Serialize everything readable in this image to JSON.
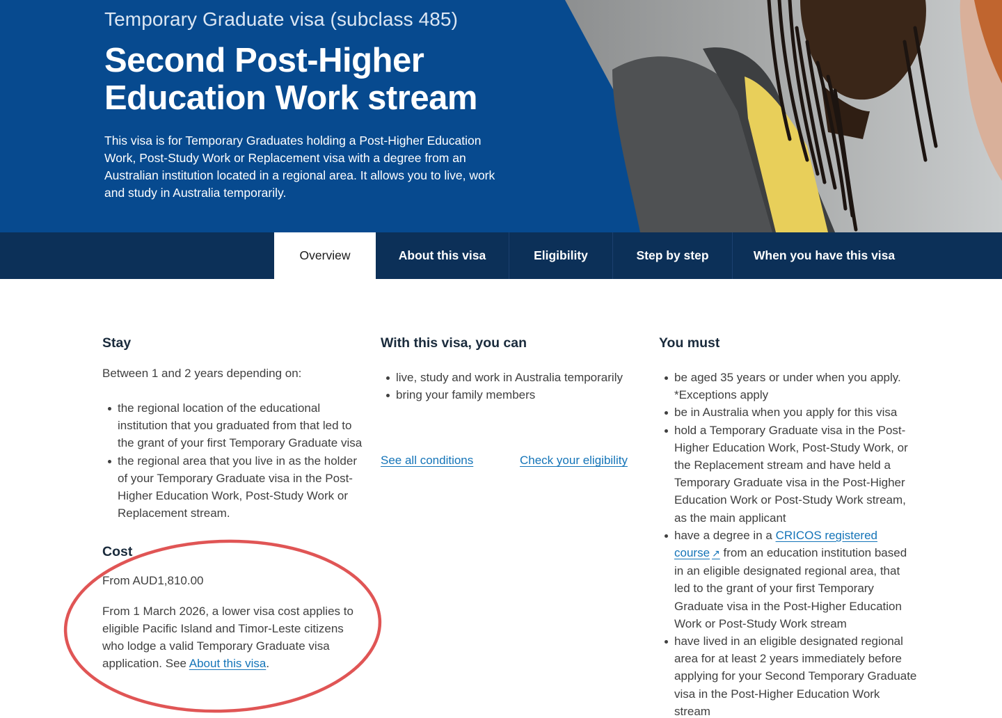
{
  "hero": {
    "subtitle": "Temporary Graduate visa (subclass 485)",
    "title_line1": "Second Post-Higher",
    "title_line2": "Education Work stream",
    "description": "This visa is for Temporary Graduates holding a Post-Higher Education Work, Post-Study Work or Replacement visa with a degree from an Australian institution located in a regional area. It allows you to live, work and study in Australia temporarily."
  },
  "tabs": [
    {
      "label": "Overview",
      "active": true
    },
    {
      "label": "About this visa"
    },
    {
      "label": "Eligibility"
    },
    {
      "label": "Step by step"
    },
    {
      "label": "When you have this visa"
    }
  ],
  "stay": {
    "heading": "Stay",
    "intro": "Between 1 and 2 years depending on:",
    "items": [
      "the regional location of the educational institution that you graduated from that led to the grant of your first Temporary Graduate visa",
      "the regional area that you live in as the holder of your Temporary Graduate visa in the Post-Higher Education Work, Post-Study Work or Replacement stream."
    ]
  },
  "cost": {
    "heading": "Cost",
    "amount": "From AUD1,810.00",
    "note": "From 1 March 2026, a lower visa cost applies to eligible Pacific Island and Timor-Leste citizens who lodge a valid Temporary Graduate visa application. See ",
    "note_link": "About this visa",
    "note_end": "."
  },
  "can": {
    "heading": "With this visa, you can",
    "items": [
      "live, study and work in Australia temporarily",
      "bring your family members"
    ],
    "link_conditions": "See all conditions",
    "link_eligibility": "Check your eligibility"
  },
  "must": {
    "heading": "You must",
    "item1": "be aged 35 years or under when you apply. *Exceptions apply",
    "item2": "be in Australia when you apply for this visa",
    "item3": "hold a Temporary Graduate visa in the Post-Higher Education Work, Post-Study Work, or the Replacement stream and have held a Temporary Graduate visa in the Post-Higher Education Work or Post-Study Work stream, as the main applicant",
    "item4_pre": "have a degree in a ",
    "item4_link": "CRICOS registered course",
    "item4_post": " from an education institution based in an eligible designated regional area, that led to the grant of your first Temporary Graduate visa in the Post-Higher Education Work or Post-Study Work stream",
    "item5": "have lived in an eligible designated regional area for at least 2 years immediately before applying for your Second Temporary Graduate visa in the Post-Higher Education Work stream"
  },
  "colors": {
    "hero_blue": "#074a8f",
    "tab_navy": "#0c3058",
    "link": "#1474b8",
    "annotation_red": "#e05555"
  },
  "icons": {
    "external_link": "↗"
  }
}
